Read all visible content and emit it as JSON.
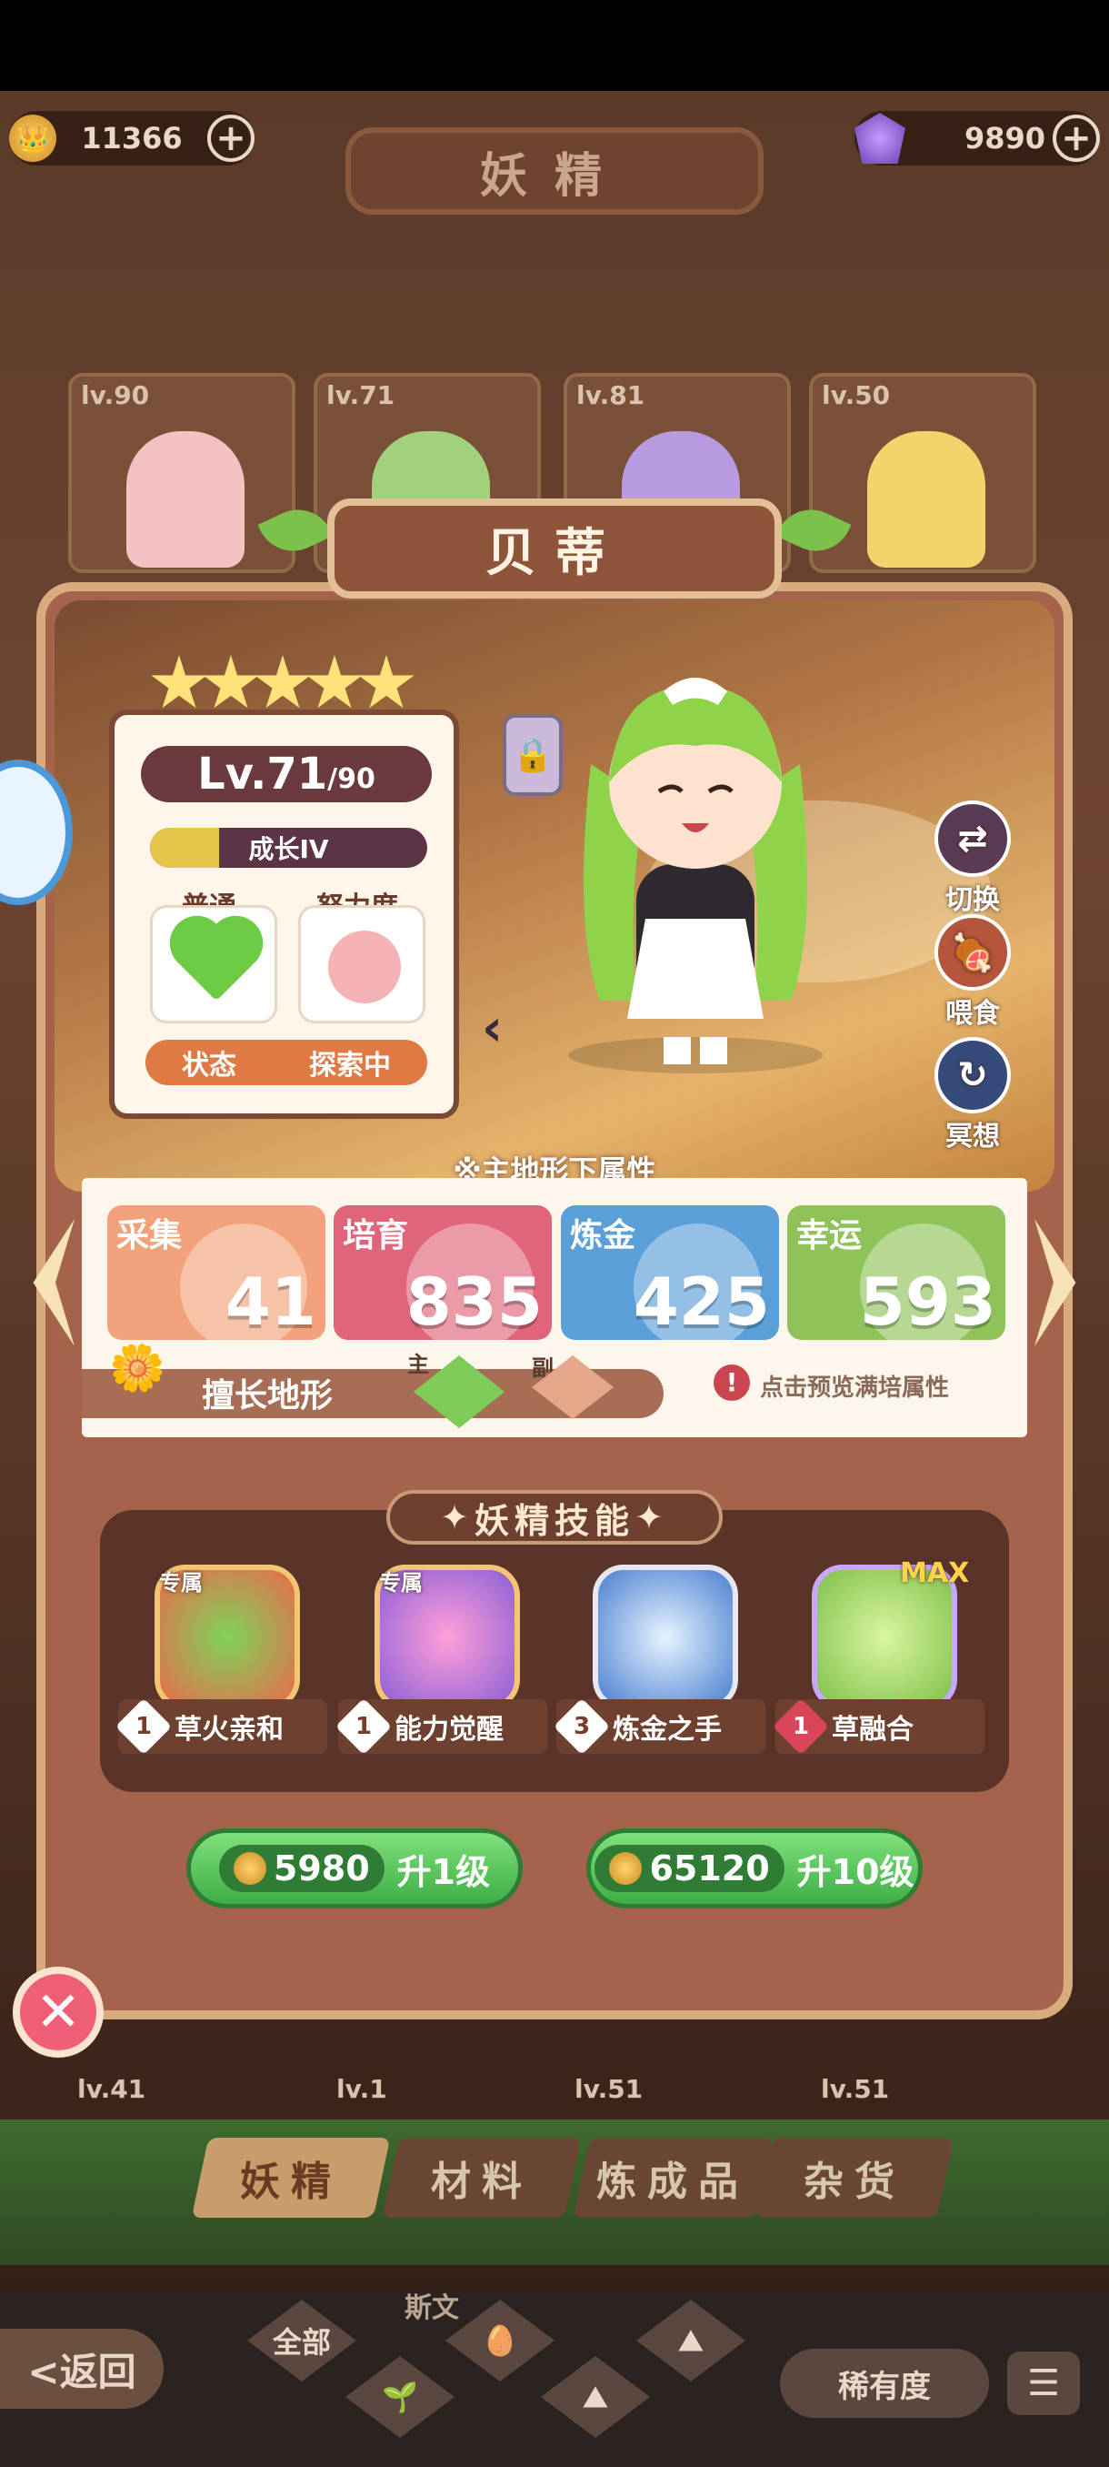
{
  "header": {
    "coins": "11366",
    "gems": "9890",
    "title": "妖精"
  },
  "roster_top": [
    {
      "level": "lv.90",
      "color": "#f3c1c1"
    },
    {
      "level": "lv.71",
      "color": "#9fd27a"
    },
    {
      "level": "lv.81",
      "color": "#b79ae0"
    },
    {
      "level": "lv.50",
      "color": "#f3d36b"
    }
  ],
  "roster_bottom": [
    {
      "level": "lv.41"
    },
    {
      "level": "lv.1"
    },
    {
      "level": "lv.51"
    },
    {
      "level": "lv.51"
    }
  ],
  "fairy": {
    "name": "贝蒂",
    "stars": 5,
    "level": "Lv.71",
    "max_level": "/90",
    "growth": "成长IV",
    "growth_progress": 0.25,
    "mood_label": "普通",
    "effort_label": "努力度",
    "status_label": "状态",
    "status_value": "探索中"
  },
  "actions": {
    "switch": "切换",
    "feed": "喂食",
    "meditate": "冥想"
  },
  "attributes": {
    "title": "※主地形下属性",
    "items": [
      {
        "name": "采集",
        "value": "41",
        "color": "#f1a27a"
      },
      {
        "name": "培育",
        "value": "835",
        "color": "#e0657a"
      },
      {
        "name": "炼金",
        "value": "425",
        "color": "#5b9fd8"
      },
      {
        "name": "幸运",
        "value": "593",
        "color": "#8fc35a"
      }
    ],
    "terrain_label": "擅长地形",
    "primary_tag": "主",
    "secondary_tag": "副",
    "hint": "点击预览满培属性"
  },
  "skills": {
    "title": "妖精技能",
    "exclusive_tag": "专属",
    "max_tag": "MAX",
    "items": [
      {
        "level": "1",
        "name": "草火亲和",
        "exclusive": true,
        "color": "#e86a4a"
      },
      {
        "level": "1",
        "name": "能力觉醒",
        "exclusive": true,
        "color": "#8a5fd6"
      },
      {
        "level": "3",
        "name": "炼金之手",
        "exclusive": false,
        "color": "#4a7fd0"
      },
      {
        "level": "1",
        "name": "草融合",
        "exclusive": false,
        "color": "#7fc04a"
      }
    ]
  },
  "upgrade": {
    "one": {
      "cost": "5980",
      "label": "升1级"
    },
    "ten": {
      "cost": "65120",
      "label": "升10级"
    }
  },
  "tabs": [
    "妖精",
    "材料",
    "炼成品",
    "杂货"
  ],
  "footer": {
    "back": "<返回",
    "all": "全部",
    "name_fragment": "斯文",
    "rarity": "稀有度"
  }
}
